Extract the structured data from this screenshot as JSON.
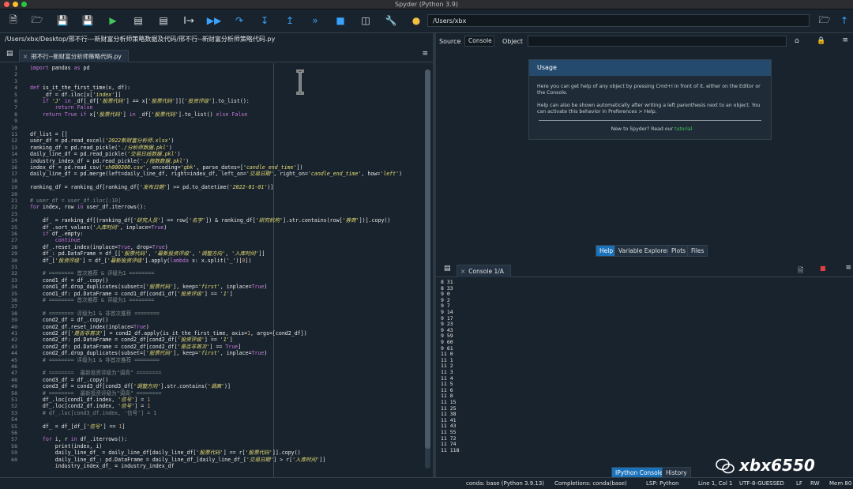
{
  "window": {
    "title": "Spyder (Python 3.9)"
  },
  "toolbar": {
    "path": "/Users/xbx"
  },
  "editor": {
    "file_path": "/Users/xbx/Desktop/邢不行---新财富分析师策略数据及代码/邢不行--新财富分析师策略代码.py",
    "tab_label": "邢不行--新财富分析师策略代码.py",
    "line_numbers": [
      "1",
      "2",
      "3",
      "4",
      "5",
      "6",
      "7",
      "8",
      "9",
      "10",
      "11",
      "12",
      "13",
      "14",
      "15",
      "16",
      "17",
      "18",
      "19",
      "20",
      "21",
      "22",
      "23",
      "24",
      "25",
      "26",
      "27",
      "28",
      "29",
      "30",
      "31",
      "32",
      "33",
      "34",
      "35",
      "36",
      "37",
      "38",
      "39",
      "40",
      "41",
      "42",
      "43",
      "44",
      "45",
      "46",
      "47",
      "48",
      "49",
      "50",
      "51",
      "52",
      "53",
      "54",
      "55",
      "56",
      "57",
      "58",
      "59",
      "60"
    ],
    "lines": [
      "import pandas as pd",
      "",
      "",
      "def is_it_the_first_time(x, df):",
      "    _df = df.iloc[x['index']]",
      "    if 'J' in _df[_df['股票代码'] == x['股票代码']]['投资评级'].to_list():",
      "        return False",
      "    return True if x['股票代码'] in _df['股票代码'].to_list() else False",
      "",
      "",
      "df_list = []",
      "user_df = pd.read_excel('2022新财富分析师.xlsx')",
      "ranking_df = pd.read_pickle('./分析师数据.pkl')",
      "daily_line_df = pd.read_pickle('交易日线数据.pkl')",
      "industry_index_df = pd.read_pickle('./指数数据.pkl')",
      "index_df = pd.read_csv('sh000300.csv', encoding='gbk', parse_dates=['candle_end_time'])",
      "daily_line_df = pd.merge(left=daily_line_df, right=index_df, left_on='交易日期', right_on='candle_end_time', how='left')",
      "",
      "ranking_df = ranking_df[ranking_df['发布日期'] >= pd.to_datetime('2022-01-01')]",
      "",
      "# user_df = user_df.iloc[:10]",
      "for index, row in user_df.iterrows():",
      "",
      "    df_ = ranking_df[(ranking_df['研究人员'] == row['名字']) & ranking_df['研究机构'].str.contains(row['券商'])].copy()",
      "    df_.sort_values('入库时间', inplace=True)",
      "    if df_.empty:",
      "        continue",
      "    df_.reset_index(inplace=True, drop=True)",
      "    df_: pd.DataFrame = df_[['股票代码', '最新投资评级', '调整方向', '入库时间']]",
      "    df_['投资评级'] = df_['最新投资评级'].apply(lambda x: x.split('_')[0])",
      "",
      "    # ======== 首次推荐 & 评级为1 ========",
      "    cond1_df = df_.copy()",
      "    cond1_df.drop_duplicates(subset=['股票代码'], keep='first', inplace=True)",
      "    cond1_df: pd.DataFrame = cond1_df[cond1_df['投资评级'] == '1']",
      "    # ======== 首次推荐 & 评级为1 ========",
      "",
      "    # ======== 评级为1 & 非首次推荐 ========",
      "    cond2_df = df_.copy()",
      "    cond2_df.reset_index(inplace=True)",
      "    cond2_df['是否非首次'] = cond2_df.apply(is_it_the_first_time, axis=1, args=[cond2_df])",
      "    cond2_df: pd.DataFrame = cond2_df[cond2_df['投资评级'] == '1']",
      "    cond2_df: pd.DataFrame = cond2_df[cond2_df['是否非首次'] == True]",
      "    cond2_df.drop_duplicates(subset=['股票代码'], keep='first', inplace=True)",
      "    # ======== 评级为1 & 非首次推荐 ========",
      "",
      "    # ========  最新投资评级为\"调高\" ========",
      "    cond3_df = df_.copy()",
      "    cond3_df = cond3_df[cond3_df['调整方向'].str.contains('调高')]",
      "    # ========  最新投资评级为\"调高\" ========",
      "    df_.loc[cond1_df.index, '信号'] = 1",
      "    df_.loc[cond2_df.index, '信号'] = 1",
      "    # df_.loc[cond3_df.index, '信号'] = 1",
      "",
      "    df_ = df_[df_['信号'] == 1]",
      "",
      "    for i, r in df_.iterrows():",
      "        print(index, i)",
      "        daily_line_df_ = daily_line_df[daily_line_df['股票代码'] == r['股票代码']].copy()",
      "        daily_line_df_: pd.DataFrame = daily_line_df_[daily_line_df_['交易日期'] > r['入库时间']]",
      "        industry_index_df_ = industry_index_df"
    ]
  },
  "help": {
    "source_label": "Source",
    "source_value": "Console",
    "object_label": "Object",
    "usage_title": "Usage",
    "usage_p1": "Here you can get help of any object by pressing Cmd+I in front of it, either on the Editor or the Console.",
    "usage_p2": "Help can also be shown automatically after writing a left parenthesis next to an object. You can activate this behavior in Preferences > Help.",
    "usage_p3_prefix": "New to Spyder? Read our ",
    "usage_p3_link": "tutorial",
    "tabs": [
      "Help",
      "Variable Explorer",
      "Plots",
      "Files"
    ]
  },
  "console": {
    "tab_label": "Console 1/A",
    "output": [
      "8 31",
      "8 33",
      "9 0",
      "9 2",
      "9 7",
      "9 14",
      "9 17",
      "9 23",
      "9 43",
      "9 59",
      "9 60",
      "9 61",
      "11 0",
      "11 1",
      "11 2",
      "11 3",
      "11 4",
      "11 5",
      "11 6",
      "11 8",
      "11 15",
      "11 25",
      "11 38",
      "11 41",
      "11 43",
      "11 55",
      "11 72",
      "11 74",
      "11 118"
    ],
    "tabs": [
      "IPython Console",
      "History"
    ]
  },
  "statusbar": {
    "env": "conda: base (Python 3.9.13)",
    "completions": "Completions: conda(base)",
    "lsp": "LSP: Python",
    "position": "Line 1, Col 1",
    "encoding": "UTF-8-GUESSED",
    "eol": "LF",
    "rw": "RW",
    "mem": "Mem 80"
  },
  "watermark": {
    "text": "xbx6550"
  },
  "colors": {
    "background": "#19232d",
    "accent": "#1a72bb",
    "usage_header": "#244a6e"
  }
}
